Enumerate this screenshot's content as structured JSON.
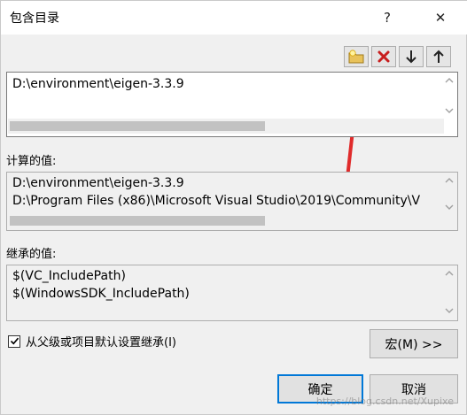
{
  "window": {
    "title": "包含目录",
    "help_glyph": "?",
    "close_glyph": "✕"
  },
  "toolbar": {
    "items": [
      {
        "icon": "new-folder-icon"
      },
      {
        "icon": "delete-icon"
      },
      {
        "icon": "move-down-icon"
      },
      {
        "icon": "move-up-icon"
      }
    ]
  },
  "annotation": {
    "arrow_color": "#e02b2b"
  },
  "edit_list": {
    "lines": [
      "D:\\environment\\eigen-3.3.9"
    ]
  },
  "evaluated": {
    "label": "计算的值:",
    "lines": [
      "D:\\environment\\eigen-3.3.9",
      "D:\\Program Files (x86)\\Microsoft Visual Studio\\2019\\Community\\V"
    ]
  },
  "inherited": {
    "label": "继承的值:",
    "lines": [
      "$(VC_IncludePath)",
      "$(WindowsSDK_IncludePath)"
    ]
  },
  "inherit_checkbox": {
    "label": "从父级或项目默认设置继承(I)",
    "checked": true
  },
  "buttons": {
    "macros": "宏(M) >>",
    "ok": "确定",
    "cancel": "取消"
  },
  "watermark": "https://blog.csdn.net/Xupixe",
  "colors": {
    "accent": "#0078d7",
    "annotation": "#e02b2b"
  }
}
